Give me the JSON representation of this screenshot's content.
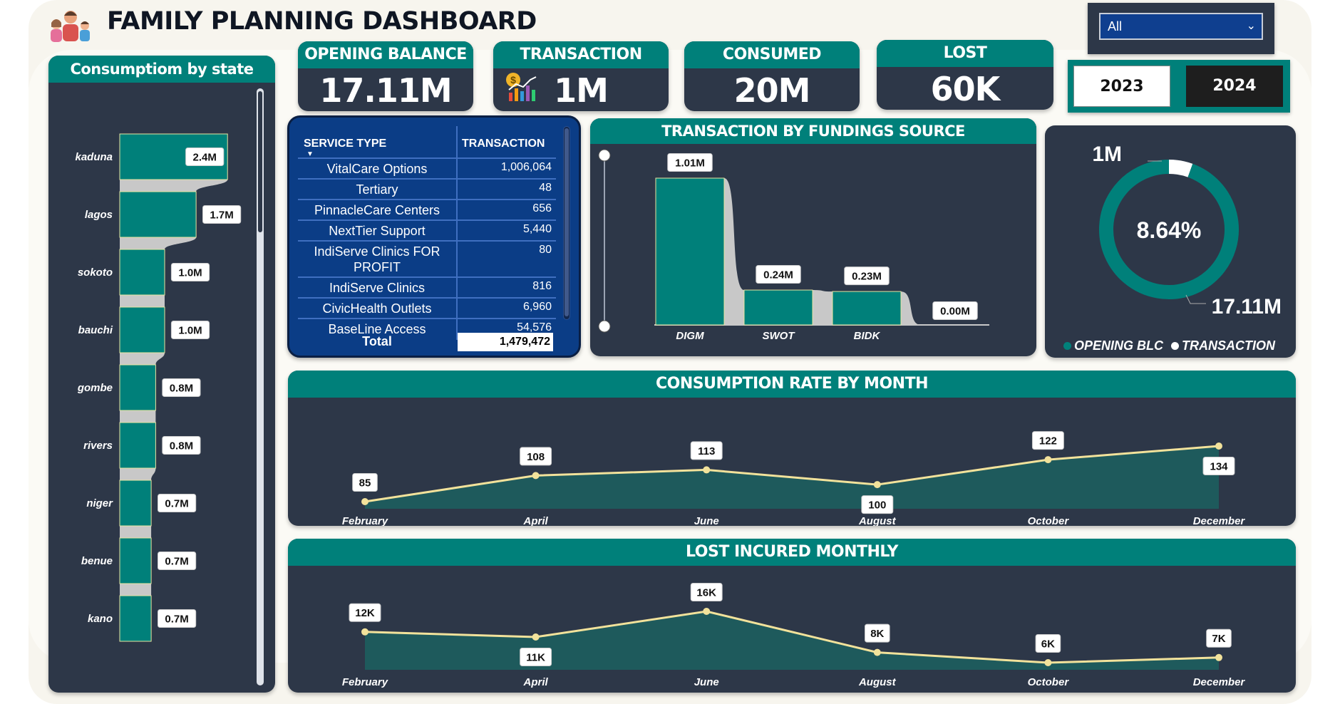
{
  "header": {
    "title": "FAMILY PLANNING DASHBOARD",
    "logo_icon": "family-icon"
  },
  "filter": {
    "value": "All",
    "icon": "chevron-down-icon"
  },
  "years": {
    "y2023": "2023",
    "y2024": "2024",
    "selected": "2024"
  },
  "kpis": {
    "opening_balance": {
      "label": "OPENING BALANCE",
      "value": "17.11M"
    },
    "transaction": {
      "label": "TRANSACTION",
      "value": "1M",
      "icon": "money-chart-icon"
    },
    "consumed": {
      "label": "CONSUMED",
      "value": "20M"
    },
    "lost": {
      "label": "LOST",
      "value": "60K"
    }
  },
  "colors": {
    "teal": "#00807a",
    "navy_card": "#2d3748",
    "table_blue": "#0b3d86",
    "line_yellow": "#f2e29b",
    "connector_gray": "#c8c8c8"
  },
  "service_table": {
    "col_service": "SERVICE TYPE",
    "col_transaction": "TRANSACTION",
    "rows": [
      {
        "name": "VitalCare Options",
        "value": "1,006,064"
      },
      {
        "name": "Tertiary",
        "value": "48"
      },
      {
        "name": "PinnacleCare Centers",
        "value": "656"
      },
      {
        "name": "NextTier Support",
        "value": "5,440"
      },
      {
        "name": "IndiServe Clinics FOR PROFIT",
        "value": "80"
      },
      {
        "name": "IndiServe Clinics",
        "value": "816"
      },
      {
        "name": "CivicHealth Outlets",
        "value": "6,960"
      },
      {
        "name": "BaseLine Access",
        "value": "54,576"
      }
    ],
    "total_label": "Total",
    "total_value": "1,479,472"
  },
  "chart_data": [
    {
      "id": "state",
      "type": "bar",
      "orientation": "horizontal",
      "title": "Consumptiom by state",
      "categories": [
        "kaduna",
        "lagos",
        "sokoto",
        "bauchi",
        "gombe",
        "rivers",
        "niger",
        "benue",
        "kano"
      ],
      "values": [
        2.4,
        1.7,
        1.0,
        1.0,
        0.8,
        0.8,
        0.7,
        0.7,
        0.7
      ],
      "labels": [
        "2.4M",
        "1.7M",
        "1.0M",
        "1.0M",
        "0.8M",
        "0.8M",
        "0.7M",
        "0.7M",
        "0.7M"
      ],
      "unit": "M"
    },
    {
      "id": "funding",
      "type": "bar",
      "title": "TRANSACTION BY FUNDINGS SOURCE",
      "categories": [
        "DIGM",
        "SWOT",
        "BIDK",
        ""
      ],
      "values": [
        1.01,
        0.24,
        0.23,
        0.0
      ],
      "labels": [
        "1.01M",
        "0.24M",
        "0.23M",
        "0.00M"
      ],
      "unit": "M"
    },
    {
      "id": "donut",
      "type": "pie",
      "style": "donut",
      "center_label": "8.64%",
      "series": [
        {
          "name": "OPENING BLC",
          "value": 17.11,
          "label": "17.11M",
          "color": "#00807a"
        },
        {
          "name": "TRANSACTION",
          "value": 1.0,
          "label": "1M",
          "color": "#ffffff"
        }
      ],
      "legend": "bottom"
    },
    {
      "id": "consumption",
      "type": "area",
      "title": "CONSUMPTION RATE BY MONTH",
      "categories": [
        "February",
        "April",
        "June",
        "August",
        "October",
        "December"
      ],
      "values": [
        85,
        108,
        113,
        100,
        122,
        134
      ],
      "labels": [
        "85",
        "108",
        "113",
        "100",
        "122",
        "134"
      ]
    },
    {
      "id": "lost",
      "type": "area",
      "title": "LOST INCURED MONTHLY",
      "categories": [
        "February",
        "April",
        "June",
        "August",
        "October",
        "December"
      ],
      "values": [
        12,
        11,
        16,
        8,
        6,
        7
      ],
      "labels": [
        "12K",
        "11K",
        "16K",
        "8K",
        "6K",
        "7K"
      ]
    }
  ]
}
